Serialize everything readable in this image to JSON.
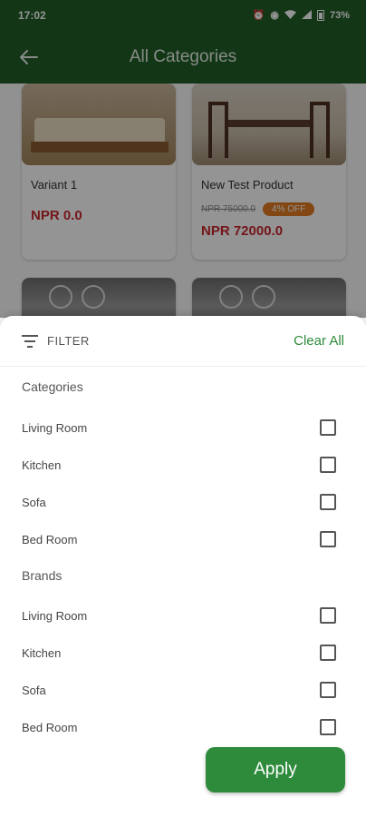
{
  "status_bar": {
    "time": "17:02",
    "battery": "73%",
    "icons": [
      "alarm-icon",
      "hotspot-icon",
      "wifi-icon",
      "signal-icon",
      "battery-icon"
    ]
  },
  "app_bar": {
    "title": "All Categories",
    "back_icon": "arrow-left-icon"
  },
  "products": [
    {
      "name": "Variant 1",
      "price": "NPR 0.0",
      "old_price": "",
      "discount": ""
    },
    {
      "name": "New Test Product",
      "price": "NPR 72000.0",
      "old_price": "NPR 75000.0",
      "discount": "4% OFF"
    }
  ],
  "filter_sheet": {
    "title": "FILTER",
    "clear_all": "Clear All",
    "categories": {
      "title": "Categories",
      "options": [
        {
          "label": "Living Room",
          "checked": false
        },
        {
          "label": "Kitchen",
          "checked": false
        },
        {
          "label": "Sofa",
          "checked": false
        },
        {
          "label": "Bed Room",
          "checked": false
        }
      ]
    },
    "brands": {
      "title": "Brands",
      "options": [
        {
          "label": "Living Room",
          "checked": false
        },
        {
          "label": "Kitchen",
          "checked": false
        },
        {
          "label": "Sofa",
          "checked": false
        },
        {
          "label": "Bed Room",
          "checked": false
        }
      ]
    },
    "apply_label": "Apply"
  },
  "colors": {
    "primary": "#1f5e27",
    "accent": "#2e8b3c",
    "price": "#c8262d",
    "badge": "#e07a22"
  }
}
